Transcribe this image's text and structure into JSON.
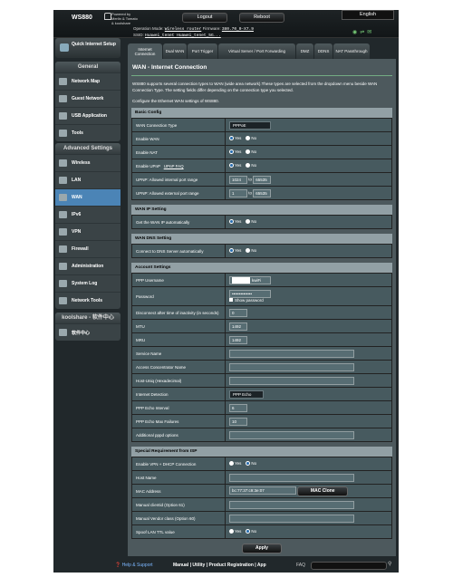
{
  "header": {
    "model": "WS880",
    "brand_line1": "Powered by",
    "brand_line2": "Merlin & Tomato",
    "brand_line3": "& koolshare",
    "logout": "Logout",
    "reboot": "Reboot",
    "language": "English",
    "opmode_label": "Operation Mode:",
    "opmode_value": "Wireless router",
    "firmware_label": "Firmware:",
    "firmware_value": "380.70_0-X7.9",
    "ssid_label": "SSID:",
    "ssid_value": "Huawei_tenet  Huawei_tenet_5G..."
  },
  "sidebar": {
    "qis": "Quick Internet Setup",
    "general_title": "General",
    "general_items": [
      "Network Map",
      "Guest Network",
      "USB Application",
      "Tools"
    ],
    "advanced_title": "Advanced Settings",
    "advanced_items": [
      "Wireless",
      "LAN",
      "WAN",
      "IPv6",
      "VPN",
      "Firewall",
      "Administration",
      "System Log",
      "Network Tools"
    ],
    "active": "WAN",
    "kool_title": "koolshare - 软件中心",
    "kool_items": [
      "软件中心"
    ]
  },
  "tabs": [
    {
      "label": "Internet Connection",
      "active": true
    },
    {
      "label": "Dual WAN"
    },
    {
      "label": "Port Trigger"
    },
    {
      "label": "Virtual Server / Port Forwarding"
    },
    {
      "label": "DMZ"
    },
    {
      "label": "DDNS"
    },
    {
      "label": "NAT Passthrough"
    }
  ],
  "page": {
    "title": "WAN - Internet Connection",
    "desc": "WS880 supports several connection types to WAN (wide area network).These types are selected from the dropdown menu beside WAN Connection Type. The setting fields differ depending on the connection type you selected.",
    "sub": "Configure the Ethernet WAN settings of WS880."
  },
  "basic": {
    "title": "Basic Config",
    "conn_type_label": "WAN Connection Type",
    "conn_type_value": "PPPoE",
    "enable_wan_label": "Enable WAN",
    "enable_nat_label": "Enable NAT",
    "enable_upnp_label": "Enable UPnP",
    "upnp_faq": "UPnP FAQ",
    "int_port_label": "UPNP: Allowed internal port range",
    "int_port_from": "1024",
    "int_port_to": "65535",
    "ext_port_label": "UPNP: Allowed external port range",
    "ext_port_from": "1",
    "ext_port_to": "65535",
    "to": "to"
  },
  "yes": "Yes",
  "no": "No",
  "wanip": {
    "title": "WAN IP Setting",
    "auto_label": "Get the WAN IP automatically"
  },
  "wandns": {
    "title": "WAN DNS Setting",
    "auto_label": "Connect to DNS Server automatically"
  },
  "account": {
    "title": "Account Settings",
    "user_label": "PPP Username",
    "user_value": "kwiFi",
    "pass_label": "Password",
    "pass_value": "••••••••••••••",
    "show_pass": "Show password",
    "idle_label": "Disconnect after time of inactivity (in seconds)",
    "idle_value": "0",
    "mtu_label": "MTU",
    "mtu_value": "1492",
    "mru_label": "MRU",
    "mru_value": "1492",
    "service_label": "Service Name",
    "ac_label": "Access Concentrator Name",
    "host_uniq_label": "Host-Uniq (Hexadecimal)",
    "detect_label": "Internet Detection",
    "detect_value": "PPP Echo",
    "echo_int_label": "PPP Echo Interval",
    "echo_int_value": "6",
    "echo_fail_label": "PPP Echo Max Failures",
    "echo_fail_value": "10",
    "pppd_label": "Additional pppd options"
  },
  "isp": {
    "title": "Special Requirement from ISP",
    "vpn_dhcp_label": "Enable VPN + DHCP Connection",
    "hostname_label": "Host Name",
    "mac_label": "MAC Address",
    "mac_value": "bc:77:37:c9:3e:07",
    "mac_clone": "MAC Clone",
    "opt61_label": "Manual clientid (Option 61)",
    "opt60_label": "Manual Vendor class (Option 60)",
    "ttl_label": "Spoof LAN TTL value"
  },
  "apply": "Apply",
  "footer": {
    "help": "Help & Support",
    "links": "Manual | Utility | Product Registration | App",
    "faq": "FAQ"
  }
}
